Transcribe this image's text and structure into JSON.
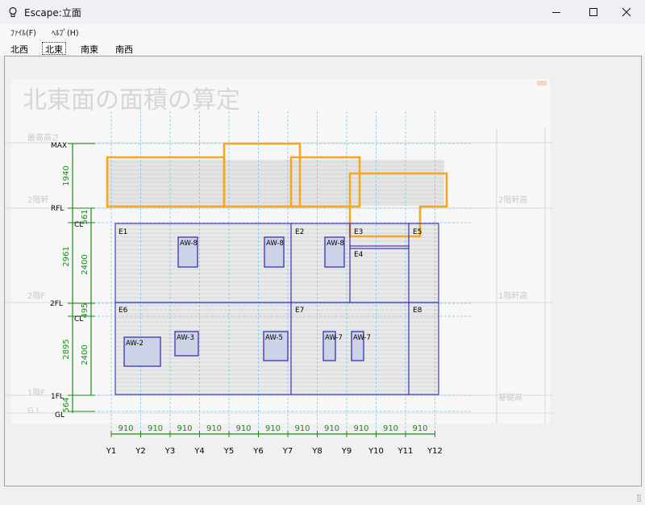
{
  "window": {
    "title": "Escape:立面",
    "app_icon": "lightbulb-icon",
    "minimize_icon": "minimize-icon",
    "maximize_icon": "maximize-icon",
    "close_icon": "close-icon"
  },
  "menu": [
    {
      "label": "ﾌｧｲﾙ(F)"
    },
    {
      "label": "ﾍﾙﾌﾟ(H)"
    }
  ],
  "tabs": [
    {
      "label": "北西",
      "active": false
    },
    {
      "label": "北東",
      "active": true
    },
    {
      "label": "南東",
      "active": false
    },
    {
      "label": "南西",
      "active": false
    }
  ],
  "drawing": {
    "bg_title": "北東面の面積の算定",
    "levels": [
      "MAX",
      "RFL",
      "CL",
      "2FL",
      "CL",
      "1FL",
      "GL"
    ],
    "dims_left": [
      "1940",
      "561",
      "2961",
      "2400",
      "495",
      "2895",
      "2400",
      "564"
    ],
    "areas": [
      "E1",
      "E2",
      "E3",
      "E4",
      "E5",
      "E6",
      "E7",
      "E8"
    ],
    "windows": [
      "AW-8",
      "AW-8",
      "AW-8",
      "AW-2",
      "AW-3",
      "AW-5",
      "AW-7",
      "AW-7"
    ],
    "span_values": [
      "910",
      "910",
      "910",
      "910",
      "910",
      "910",
      "910",
      "910",
      "910",
      "910",
      "910"
    ],
    "grid_labels": [
      "Y1",
      "Y2",
      "Y3",
      "Y4",
      "Y5",
      "Y6",
      "Y7",
      "Y8",
      "Y9",
      "Y10",
      "Y11",
      "Y12"
    ],
    "ghost_texts": [
      "最高高さ",
      "2階軒",
      "2階F",
      "1階F",
      "G.L",
      "2階軒高",
      "1階軒高",
      "基礎高"
    ],
    "colors": {
      "roof": "#f5a623",
      "area": "#3a2fb8",
      "dimension": "#1a8a1a",
      "grid": "#7cc8ee"
    }
  }
}
